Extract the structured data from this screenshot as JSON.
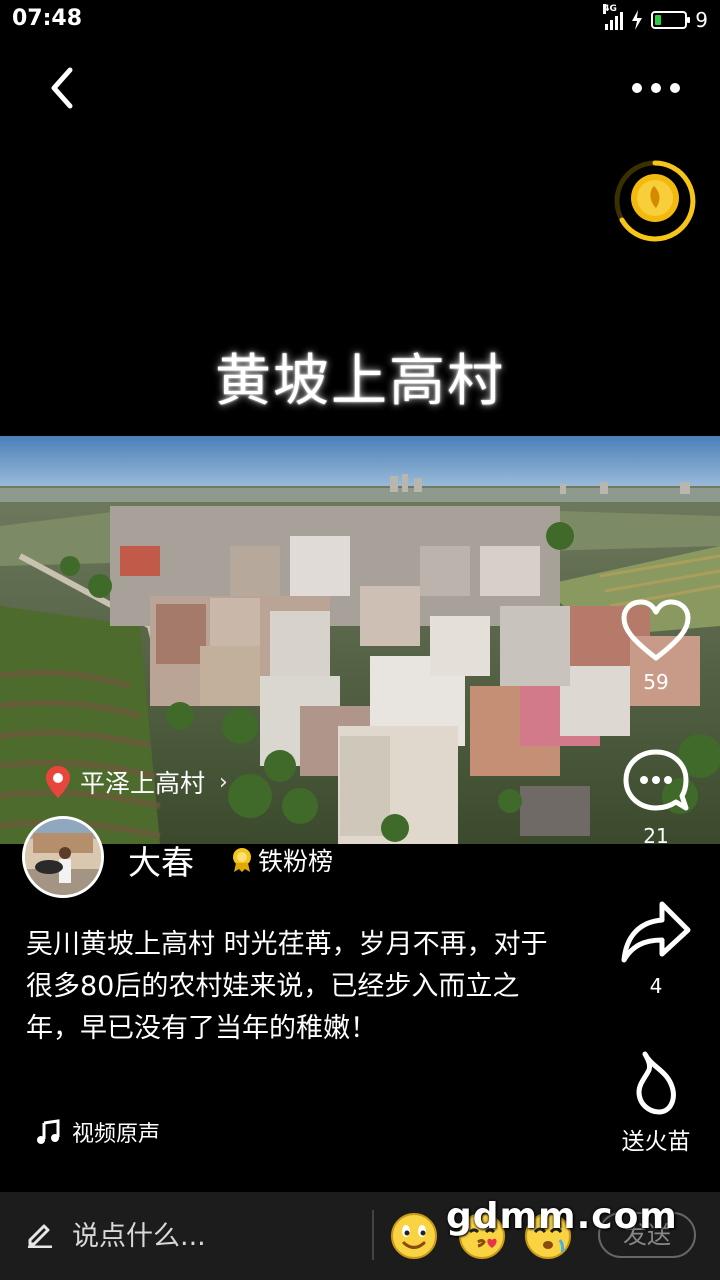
{
  "status_bar": {
    "time": "07:48",
    "network": "4G",
    "battery": "9",
    "icons": [
      "signal-icon",
      "charging-icon",
      "battery-icon"
    ]
  },
  "header": {
    "back_icon": "chevron-left-icon",
    "more_icon": "more-dots-icon",
    "coin_icon": "gold-coin-icon"
  },
  "video": {
    "title_overlay": "黄坡上高村",
    "location": "平泽上高村"
  },
  "side_actions": {
    "like_count": "59",
    "comment_count": "21",
    "share_count": "4",
    "fire_label": "送火苗"
  },
  "author": {
    "name": "大春",
    "badge": "铁粉榜"
  },
  "post": {
    "description": " 吴川黄坡上高村 时光荏苒，岁月不再，对于很多80后的农村娃来说，已经步入而立之年，早已没有了当年的稚嫩！",
    "music": "视频原声"
  },
  "bottom_bar": {
    "input_placeholder": "说点什么...",
    "send_label": "发送",
    "watermark": "gdmm.com"
  },
  "colors": {
    "background": "#000000",
    "accent_gold": "#f5c518",
    "battery_green": "#2ecc40",
    "location_pin": "#e8463c",
    "bottom_bar": "#1c1c1c"
  }
}
